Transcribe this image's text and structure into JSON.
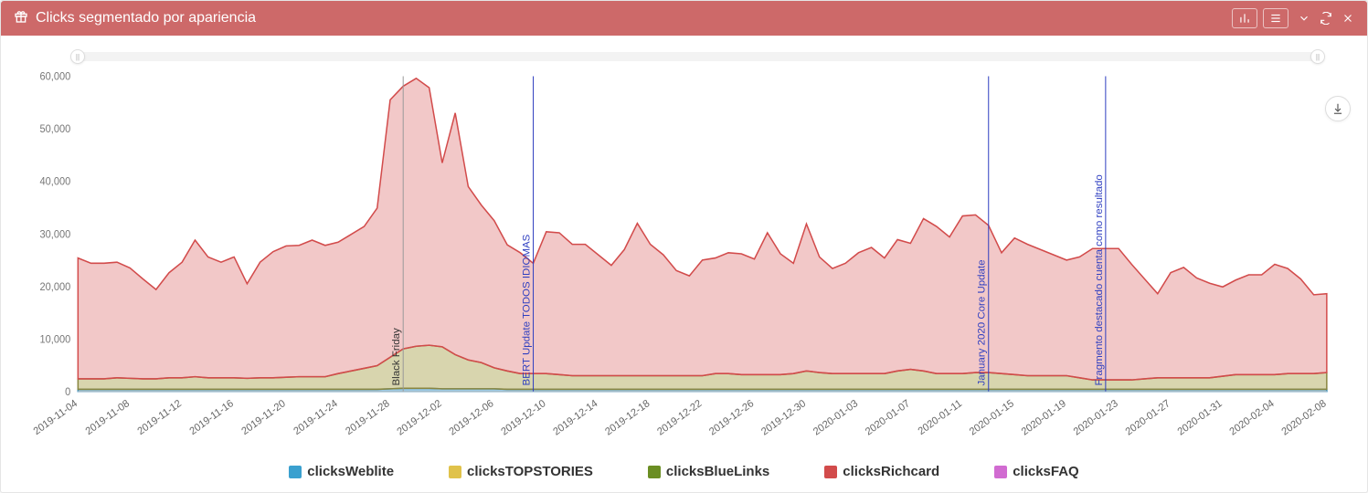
{
  "panel": {
    "title": "Clicks segmentado por apariencia"
  },
  "chart_data": {
    "type": "area",
    "title": "Clicks segmentado por apariencia",
    "xlabel": "",
    "ylabel": "",
    "ylim": [
      0,
      60000
    ],
    "y_ticks": [
      0,
      10000,
      20000,
      30000,
      40000,
      50000,
      60000
    ],
    "y_tick_labels": [
      "0",
      "10,000",
      "20,000",
      "30,000",
      "40,000",
      "50,000",
      "60,000"
    ],
    "categories": [
      "2019-11-04",
      "2019-11-05",
      "2019-11-06",
      "2019-11-07",
      "2019-11-08",
      "2019-11-09",
      "2019-11-10",
      "2019-11-11",
      "2019-11-12",
      "2019-11-13",
      "2019-11-14",
      "2019-11-15",
      "2019-11-16",
      "2019-11-17",
      "2019-11-18",
      "2019-11-19",
      "2019-11-20",
      "2019-11-21",
      "2019-11-22",
      "2019-11-23",
      "2019-11-24",
      "2019-11-25",
      "2019-11-26",
      "2019-11-27",
      "2019-11-28",
      "2019-11-29",
      "2019-11-30",
      "2019-12-01",
      "2019-12-02",
      "2019-12-03",
      "2019-12-04",
      "2019-12-05",
      "2019-12-06",
      "2019-12-07",
      "2019-12-08",
      "2019-12-09",
      "2019-12-10",
      "2019-12-11",
      "2019-12-12",
      "2019-12-13",
      "2019-12-14",
      "2019-12-15",
      "2019-12-16",
      "2019-12-17",
      "2019-12-18",
      "2019-12-19",
      "2019-12-20",
      "2019-12-21",
      "2019-12-22",
      "2019-12-23",
      "2019-12-24",
      "2019-12-25",
      "2019-12-26",
      "2019-12-27",
      "2019-12-28",
      "2019-12-29",
      "2019-12-30",
      "2019-12-31",
      "2020-01-01",
      "2020-01-02",
      "2020-01-03",
      "2020-01-04",
      "2020-01-05",
      "2020-01-06",
      "2020-01-07",
      "2020-01-08",
      "2020-01-09",
      "2020-01-10",
      "2020-01-11",
      "2020-01-12",
      "2020-01-13",
      "2020-01-14",
      "2020-01-15",
      "2020-01-16",
      "2020-01-17",
      "2020-01-18",
      "2020-01-19",
      "2020-01-20",
      "2020-01-21",
      "2020-01-22",
      "2020-01-23",
      "2020-01-24",
      "2020-01-25",
      "2020-01-26",
      "2020-01-27",
      "2020-01-28",
      "2020-01-29",
      "2020-01-30",
      "2020-01-31",
      "2020-02-01",
      "2020-02-02",
      "2020-02-03",
      "2020-02-04",
      "2020-02-05",
      "2020-02-06",
      "2020-02-07",
      "2020-02-08"
    ],
    "x_tick_labels": [
      "2019-11-04",
      "2019-11-08",
      "2019-11-12",
      "2019-11-16",
      "2019-11-20",
      "2019-11-24",
      "2019-11-28",
      "2019-12-02",
      "2019-12-06",
      "2019-12-10",
      "2019-12-14",
      "2019-12-18",
      "2019-12-22",
      "2019-12-26",
      "2019-12-30",
      "2020-01-03",
      "2020-01-07",
      "2020-01-11",
      "2020-01-15",
      "2020-01-19",
      "2020-01-23",
      "2020-01-27",
      "2020-01-31",
      "2020-02-04",
      "2020-02-08"
    ],
    "series": [
      {
        "name": "clicksWeblite",
        "color": "#3aa0cf",
        "values": [
          400,
          400,
          400,
          400,
          400,
          400,
          400,
          400,
          400,
          400,
          400,
          400,
          400,
          400,
          400,
          400,
          400,
          400,
          400,
          400,
          400,
          400,
          400,
          400,
          500,
          600,
          600,
          600,
          500,
          500,
          500,
          500,
          500,
          400,
          400,
          400,
          400,
          400,
          400,
          400,
          400,
          400,
          400,
          400,
          400,
          400,
          400,
          400,
          400,
          400,
          400,
          400,
          400,
          400,
          400,
          400,
          400,
          400,
          400,
          400,
          400,
          400,
          400,
          400,
          400,
          400,
          400,
          400,
          400,
          400,
          400,
          400,
          400,
          400,
          400,
          400,
          400,
          400,
          400,
          400,
          400,
          400,
          400,
          400,
          400,
          400,
          400,
          400,
          400,
          400,
          400,
          400,
          400,
          400,
          400,
          400,
          400
        ]
      },
      {
        "name": "clicksTOPSTORIES",
        "color": "#e0c24a",
        "values": [
          0,
          0,
          0,
          0,
          0,
          0,
          0,
          0,
          0,
          0,
          0,
          0,
          0,
          0,
          0,
          0,
          0,
          0,
          0,
          0,
          0,
          0,
          0,
          0,
          0,
          0,
          0,
          0,
          0,
          0,
          0,
          0,
          0,
          0,
          0,
          0,
          0,
          0,
          0,
          0,
          0,
          0,
          0,
          0,
          0,
          0,
          0,
          0,
          0,
          0,
          0,
          0,
          0,
          0,
          0,
          0,
          0,
          0,
          0,
          0,
          0,
          0,
          0,
          0,
          0,
          0,
          0,
          0,
          0,
          0,
          0,
          0,
          0,
          0,
          0,
          0,
          0,
          0,
          0,
          0,
          0,
          0,
          0,
          0,
          0,
          0,
          0,
          0,
          0,
          0,
          0,
          0,
          0,
          0,
          0,
          0,
          0
        ]
      },
      {
        "name": "clicksBlueLinks",
        "color": "#6b8e23",
        "values": [
          2000,
          2000,
          2000,
          2200,
          2100,
          2000,
          2000,
          2200,
          2200,
          2400,
          2200,
          2200,
          2200,
          2100,
          2200,
          2200,
          2300,
          2400,
          2400,
          2400,
          3000,
          3500,
          4000,
          4500,
          6000,
          7500,
          8000,
          8200,
          8000,
          6500,
          5500,
          5000,
          4000,
          3500,
          3000,
          3000,
          3000,
          2800,
          2600,
          2600,
          2600,
          2600,
          2600,
          2600,
          2600,
          2600,
          2600,
          2600,
          2600,
          3000,
          3000,
          2800,
          2800,
          2800,
          2800,
          3000,
          3500,
          3200,
          3000,
          3000,
          3000,
          3000,
          3000,
          3500,
          3800,
          3500,
          3000,
          3000,
          3000,
          3200,
          3200,
          3000,
          2800,
          2600,
          2600,
          2600,
          2600,
          2200,
          1800,
          1800,
          1800,
          1800,
          2000,
          2200,
          2200,
          2200,
          2200,
          2200,
          2500,
          2800,
          2800,
          2800,
          2800,
          3000,
          3000,
          3000,
          3200
        ]
      },
      {
        "name": "clicksRichcard",
        "color": "#d24b4b",
        "values": [
          23000,
          22000,
          22000,
          22000,
          21000,
          19000,
          17000,
          20000,
          22000,
          26000,
          23000,
          22000,
          23000,
          18000,
          22000,
          24000,
          25000,
          25000,
          26000,
          25000,
          25000,
          26000,
          27000,
          30000,
          49000,
          50000,
          51000,
          49000,
          35000,
          46000,
          33000,
          30000,
          28000,
          24000,
          23000,
          21000,
          27000,
          27000,
          25000,
          25000,
          23000,
          21000,
          24000,
          29000,
          25000,
          23000,
          20000,
          19000,
          22000,
          22000,
          23000,
          23000,
          22000,
          27000,
          23000,
          21000,
          28000,
          22000,
          20000,
          21000,
          23000,
          24000,
          22000,
          25000,
          24000,
          29000,
          28000,
          26000,
          30000,
          30000,
          28000,
          23000,
          26000,
          25000,
          24000,
          23000,
          22000,
          23000,
          25000,
          25000,
          25000,
          22000,
          19000,
          16000,
          20000,
          21000,
          19000,
          18000,
          17000,
          18000,
          19000,
          19000,
          21000,
          20000,
          18000,
          15000,
          15000
        ]
      },
      {
        "name": "clicksFAQ",
        "color": "#d16bd1",
        "values": [
          0,
          0,
          0,
          0,
          0,
          0,
          0,
          0,
          0,
          0,
          0,
          0,
          0,
          0,
          0,
          0,
          0,
          0,
          0,
          0,
          0,
          0,
          0,
          0,
          0,
          0,
          0,
          0,
          0,
          0,
          0,
          0,
          0,
          0,
          0,
          0,
          0,
          0,
          0,
          0,
          0,
          0,
          0,
          0,
          0,
          0,
          0,
          0,
          0,
          0,
          0,
          0,
          0,
          0,
          0,
          0,
          0,
          0,
          0,
          0,
          0,
          0,
          0,
          0,
          0,
          0,
          0,
          0,
          0,
          0,
          0,
          0,
          0,
          0,
          0,
          0,
          0,
          0,
          0,
          0,
          0,
          0,
          0,
          0,
          0,
          0,
          0,
          0,
          0,
          0,
          0,
          0,
          0,
          0,
          0,
          0,
          0
        ]
      }
    ],
    "annotations": [
      {
        "x": "2019-11-29",
        "label": "Black Friday",
        "color": "#555"
      },
      {
        "x": "2019-12-09",
        "label": "BERT Update TODOS IDIOMAS",
        "color": "#2e3ec0"
      },
      {
        "x": "2020-01-13",
        "label": "January 2020 Core Update",
        "color": "#2e3ec0"
      },
      {
        "x": "2020-01-22",
        "label": "Fragmento destacado cuenta como resultado",
        "color": "#2e3ec0"
      }
    ]
  },
  "legend": {
    "items": [
      {
        "label": "clicksWeblite",
        "color": "#3aa0cf"
      },
      {
        "label": "clicksTOPSTORIES",
        "color": "#e0c24a"
      },
      {
        "label": "clicksBlueLinks",
        "color": "#6b8e23"
      },
      {
        "label": "clicksRichcard",
        "color": "#d24b4b"
      },
      {
        "label": "clicksFAQ",
        "color": "#d16bd1"
      }
    ]
  }
}
